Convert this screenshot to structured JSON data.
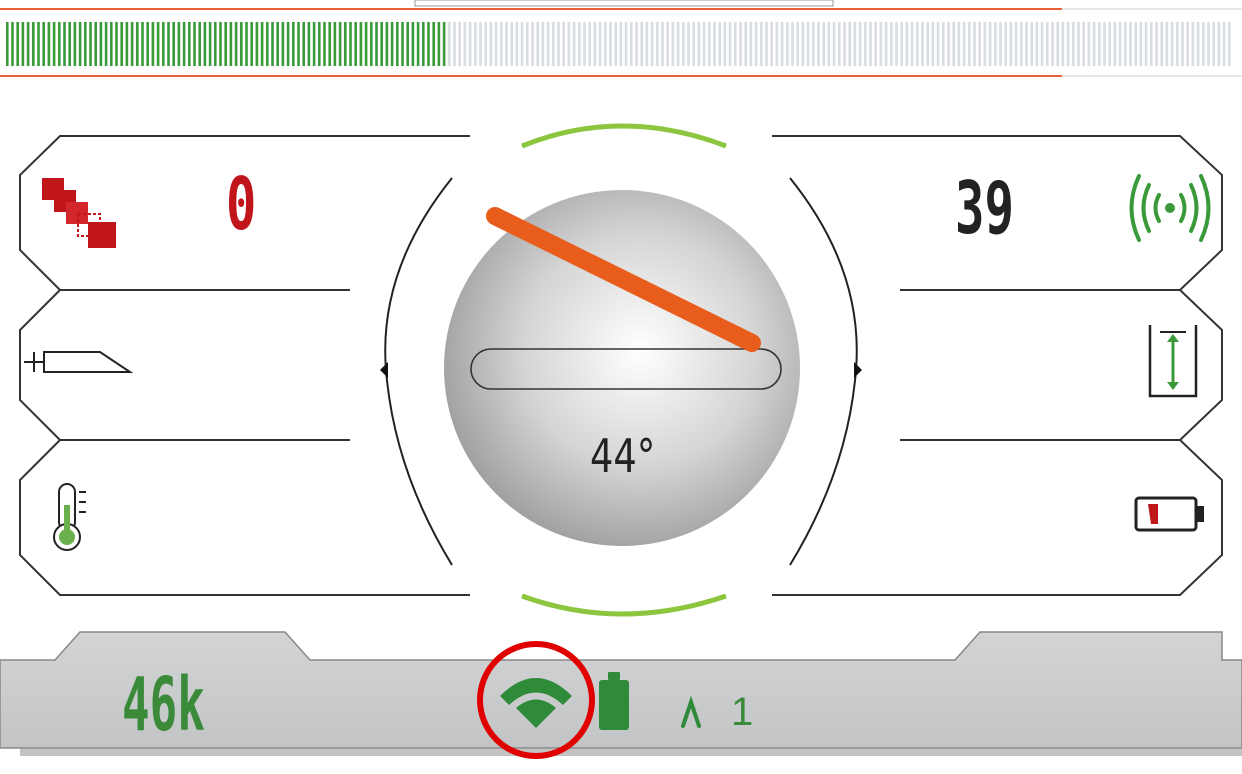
{
  "signal_bar": {
    "fill_fraction": 0.36,
    "fill_color": "#3a9a3a",
    "empty_color": "#d8dde3",
    "accent_line_color": "#e8603a"
  },
  "left_panel": {
    "count_value": "0",
    "count_color": "#c0161b",
    "items": [
      {
        "icon": "stacked-squares-icon"
      },
      {
        "icon": "sonde-probe-icon"
      },
      {
        "icon": "thermometer-icon"
      }
    ]
  },
  "right_panel": {
    "signal_value": "39",
    "items": [
      {
        "icon": "broadcast-signal-icon"
      },
      {
        "icon": "depth-icon"
      },
      {
        "icon": "battery-low-icon"
      }
    ]
  },
  "dial": {
    "pitch_angle_text": "44°",
    "needle_color": "#e85c1c",
    "arc_color": "#8cc63f"
  },
  "status_bar": {
    "frequency": "46k",
    "antenna_number": "1",
    "text_color": "#3a8a3a",
    "background": "#c9cbcd",
    "highlight_circle_color": "#e00000"
  }
}
